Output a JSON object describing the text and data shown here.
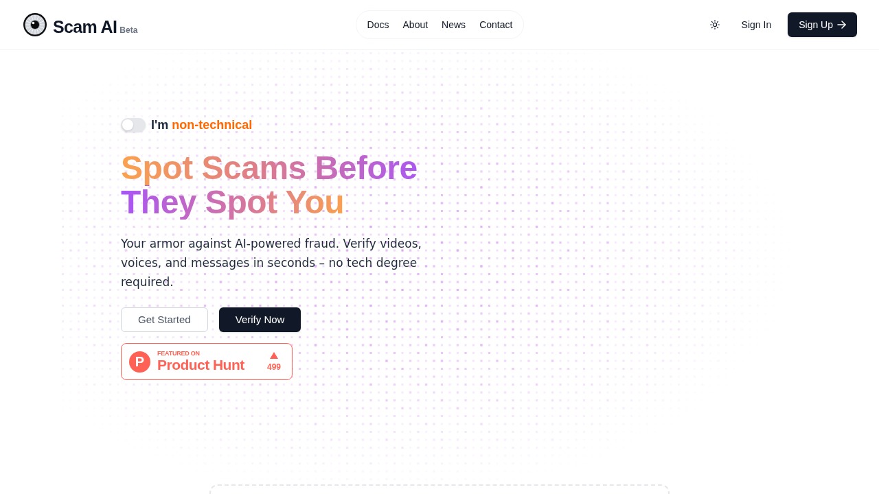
{
  "header": {
    "brand": {
      "name": "Scam AI",
      "badge": "Beta"
    },
    "nav": [
      {
        "label": "Docs"
      },
      {
        "label": "About"
      },
      {
        "label": "News"
      },
      {
        "label": "Contact"
      }
    ],
    "sign_in": "Sign In",
    "sign_up": "Sign Up"
  },
  "hero": {
    "mode_toggle": {
      "on": false,
      "prefix": "I'm",
      "highlight": "non-technical"
    },
    "headline": "Spot Scams Before They Spot You",
    "subtitle": "Your armor against AI-powered fraud. Verify videos, voices, and messages in seconds – no tech degree required.",
    "buttons": [
      {
        "label": "Get Started",
        "kind": "outline"
      },
      {
        "label": "Verify Now",
        "kind": "primary"
      }
    ],
    "product_hunt": {
      "logo_letter": "P",
      "eyebrow": "FEATURED ON",
      "name": "Product Hunt",
      "upvotes": "499"
    }
  }
}
